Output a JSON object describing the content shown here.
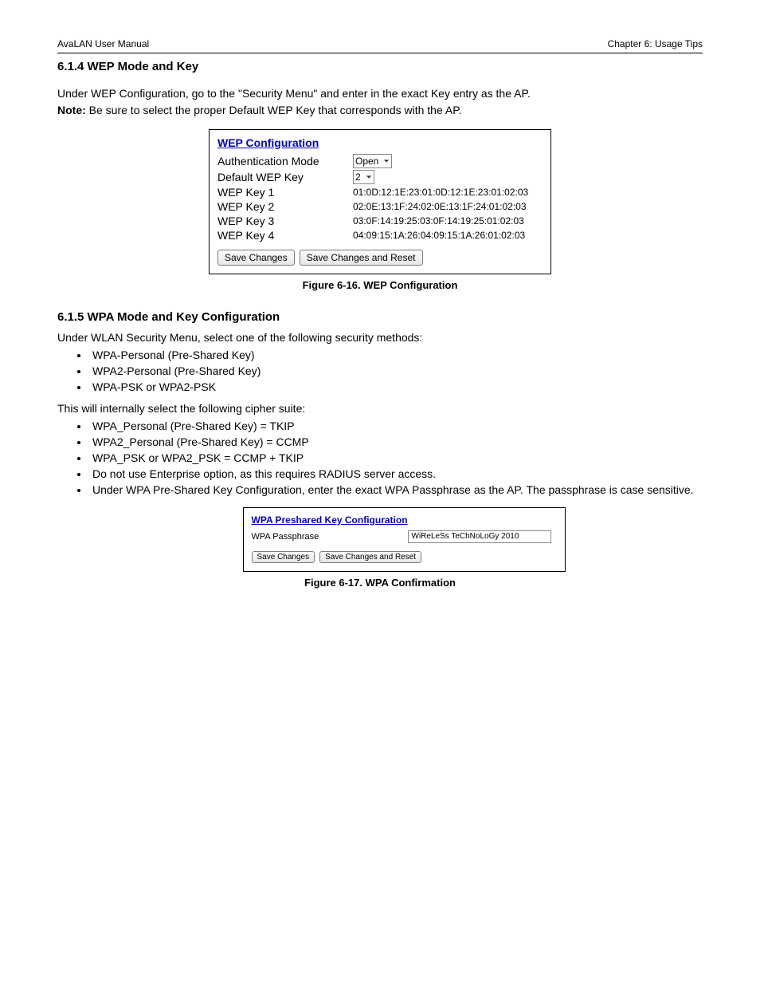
{
  "header": {
    "left": "AvaLAN User Manual",
    "right": "Chapter 6: Usage Tips"
  },
  "section": {
    "title": "6.1.4  WEP Mode and Key",
    "p1": "Under WEP Configuration, go to the \"Security Menu\" and enter in the exact Key entry as the AP.",
    "note_label": "Note: ",
    "note_body": "Be sure to select the proper Default WEP Key that corresponds with the AP."
  },
  "wep_panel": {
    "title": "WEP Configuration",
    "rows": [
      {
        "label": "Authentication Mode",
        "value": "Open",
        "type": "select"
      },
      {
        "label": "Default WEP Key",
        "value": "2",
        "type": "select"
      },
      {
        "label": "WEP Key 1",
        "value": "01:0D:12:1E:23:01:0D:12:1E:23:01:02:03",
        "type": "text"
      },
      {
        "label": "WEP Key 2",
        "value": "02:0E:13:1F:24:02:0E:13:1F:24:01:02:03",
        "type": "text"
      },
      {
        "label": "WEP Key 3",
        "value": "03:0F:14:19:25:03:0F:14:19:25:01:02:03",
        "type": "text"
      },
      {
        "label": "WEP Key 4",
        "value": "04:09:15:1A:26:04:09:15:1A:26:01:02:03",
        "type": "text"
      }
    ],
    "buttons": {
      "save": "Save Changes",
      "save_reset": "Save Changes and Reset"
    },
    "caption": "Figure 6-16.  WEP Configuration"
  },
  "section2": {
    "title": "6.1.5  WPA Mode and Key Configuration",
    "intro": "Under WLAN Security Menu, select one of the following security methods:",
    "list1": [
      "WPA-Personal (Pre-Shared Key)",
      "WPA2-Personal (Pre-Shared Key)",
      "WPA-PSK or WPA2-PSK"
    ],
    "mid": "This will internally select the following cipher suite:",
    "list2": [
      "WPA_Personal (Pre-Shared Key) = TKIP",
      "WPA2_Personal (Pre-Shared Key) = CCMP",
      "WPA_PSK or WPA2_PSK = CCMP + TKIP",
      "Do not use Enterprise option, as this requires RADIUS server access.",
      "Under WPA Pre-Shared Key Configuration, enter the exact WPA Passphrase as the AP. The passphrase is case sensitive."
    ]
  },
  "wpa_panel": {
    "title": "WPA Preshared Key Configuration",
    "label": "WPA Passphrase",
    "value": "WiReLeSs TeChNoLoGy 2010",
    "buttons": {
      "save": "Save Changes",
      "save_reset": "Save Changes and Reset"
    },
    "caption": "Figure 6-17.  WPA Confirmation"
  }
}
